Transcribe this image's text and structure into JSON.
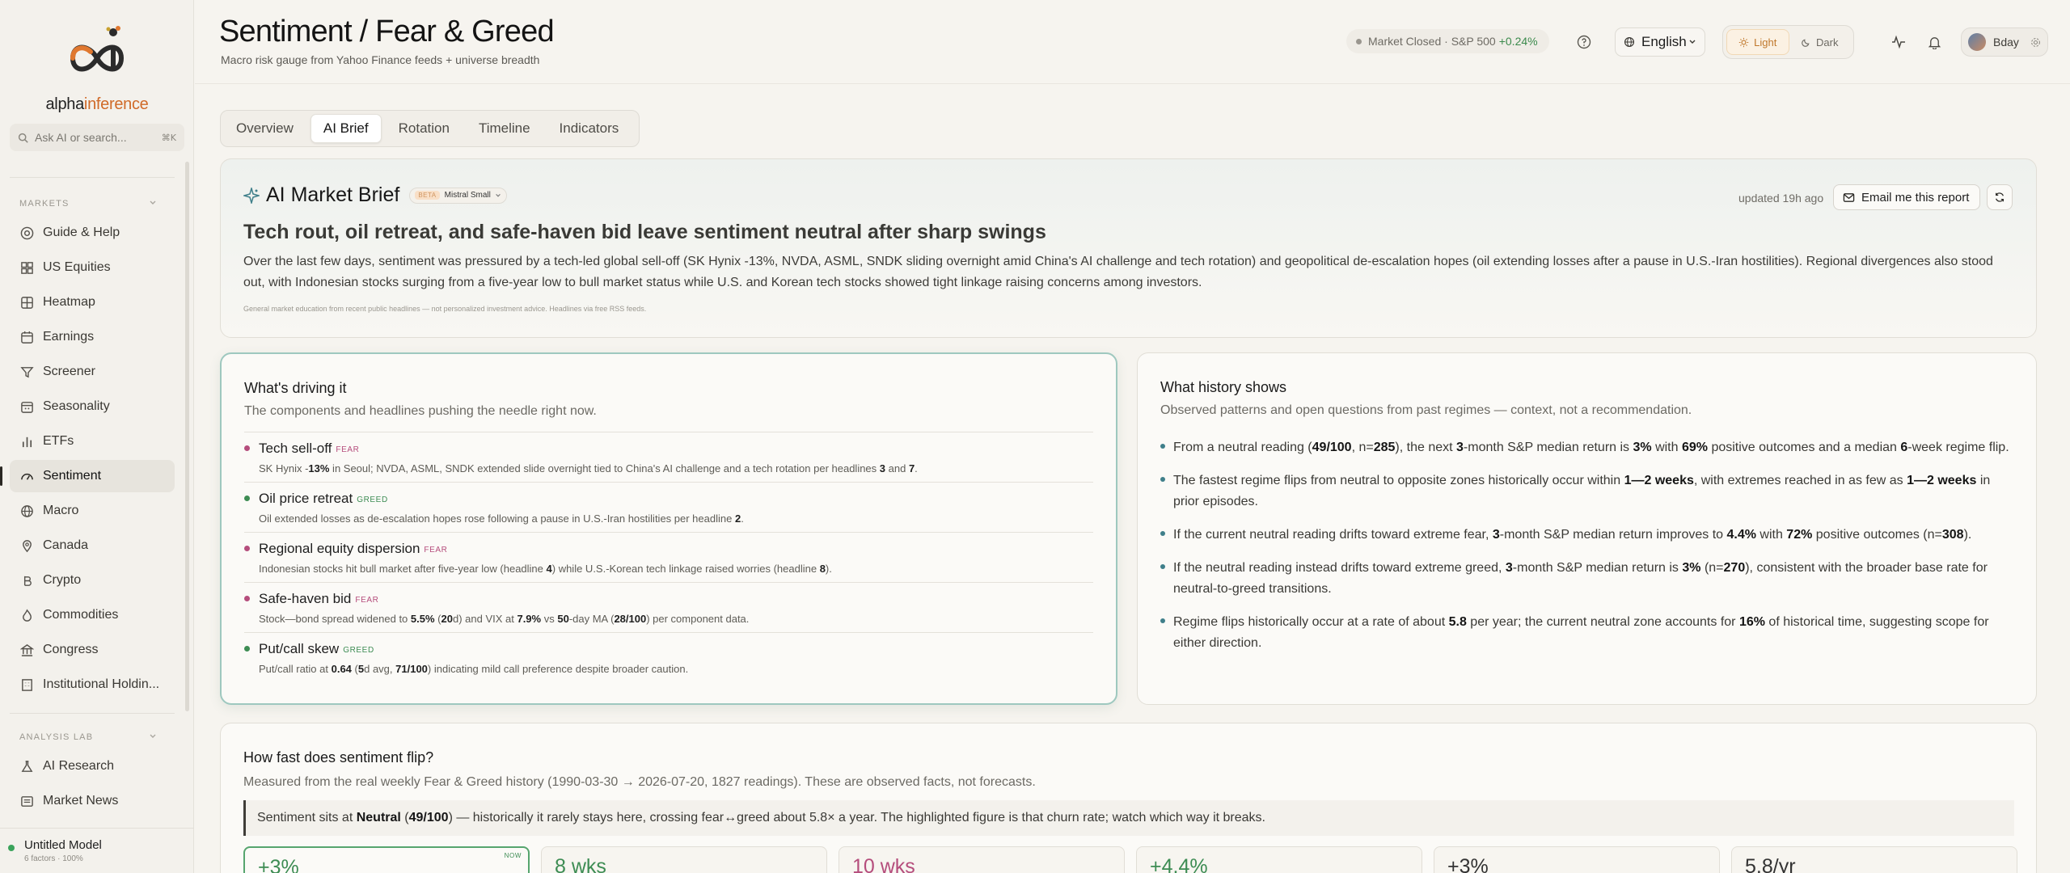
{
  "sidebar": {
    "brand_main": "alpha",
    "brand_accent": "inference",
    "search_placeholder": "Ask AI or search...",
    "search_kbd": "⌘K",
    "sections": [
      {
        "label": "MARKETS"
      },
      {
        "label": "ANALYSIS LAB"
      }
    ],
    "items": [
      {
        "label": "Guide & Help",
        "icon": "guide-icon"
      },
      {
        "label": "US Equities",
        "icon": "grid-icon"
      },
      {
        "label": "Heatmap",
        "icon": "heatmap-icon"
      },
      {
        "label": "Earnings",
        "icon": "calendar-icon"
      },
      {
        "label": "Screener",
        "icon": "filter-icon"
      },
      {
        "label": "Seasonality",
        "icon": "calendar-icon"
      },
      {
        "label": "ETFs",
        "icon": "bar-chart-icon"
      },
      {
        "label": "Sentiment",
        "icon": "gauge-icon",
        "active": true
      },
      {
        "label": "Macro",
        "icon": "globe-icon"
      },
      {
        "label": "Canada",
        "icon": "map-pin-icon"
      },
      {
        "label": "Crypto",
        "icon": "bitcoin-icon"
      },
      {
        "label": "Commodities",
        "icon": "flame-icon"
      },
      {
        "label": "Congress",
        "icon": "landmark-icon"
      },
      {
        "label": "Institutional Holdin...",
        "icon": "building-icon"
      }
    ],
    "lab_items": [
      {
        "label": "AI Research",
        "icon": "flask-icon"
      },
      {
        "label": "Market News",
        "icon": "newspaper-icon"
      }
    ],
    "model": {
      "name": "Untitled Model",
      "meta": "6 factors · 100%"
    }
  },
  "header": {
    "title": "Sentiment / Fear & Greed",
    "subtitle": "Macro risk gauge from Yahoo Finance feeds + universe breadth",
    "market_status": "Market Closed · S&P 500",
    "market_change": "+0.24%",
    "language": "English",
    "theme_light": "Light",
    "theme_dark": "Dark",
    "user": "Bday"
  },
  "tabs": [
    "Overview",
    "AI Brief",
    "Rotation",
    "Timeline",
    "Indicators"
  ],
  "brief": {
    "title": "AI Market Brief",
    "beta": "BETA",
    "model": "Mistral Small",
    "updated": "updated 19h ago",
    "email_label": "Email me this report",
    "headline": "Tech rout, oil retreat, and safe-haven bid leave sentiment neutral after sharp swings",
    "body": "Over the last few days, sentiment was pressured by a tech-led global sell-off (SK Hynix -13%, NVDA, ASML, SNDK sliding overnight amid China's AI challenge and tech rotation) and geopolitical de-escalation hopes (oil extending losses after a pause in U.S.-Iran hostilities). Regional divergences also stood out, with Indonesian stocks surging from a five-year low to bull market status while U.S. and Korean tech stocks showed tight linkage raising concerns among investors.",
    "note": "General market education from recent public headlines — not personalized investment advice. Headlines via free RSS feeds."
  },
  "drivers": {
    "title": "What's driving it",
    "subtitle": "The components and headlines pushing the needle right now.",
    "items": [
      {
        "title": "Tech sell-off",
        "tag": "FEAR",
        "d": [
          "SK Hynix -",
          "13%",
          " in Seoul; NVDA, ASML, SNDK extended slide overnight tied to China's AI challenge and a tech rotation per headlines ",
          "3",
          " and ",
          "7",
          "."
        ]
      },
      {
        "title": "Oil price retreat",
        "tag": "GREED",
        "d": [
          "Oil extended losses as de-escalation hopes rose following a pause in U.S.-Iran hostilities per headline ",
          "2",
          ".",
          "",
          "",
          "",
          ""
        ]
      },
      {
        "title": "Regional equity dispersion",
        "tag": "FEAR",
        "d": [
          "Indonesian stocks hit bull market after five-year low (headline ",
          "4",
          ") while U.S.-Korean tech linkage raised worries (headline ",
          "8",
          ").",
          "",
          ""
        ]
      },
      {
        "title": "Safe-haven bid",
        "tag": "FEAR",
        "d": [
          "Stock—bond spread widened to ",
          "5.5%",
          " (",
          "20",
          "d) and VIX at ",
          "7.9%",
          " vs ",
          "50",
          "-day MA (",
          "28/100",
          ") per component data."
        ]
      },
      {
        "title": "Put/call skew",
        "tag": "GREED",
        "d": [
          "Put/call ratio at ",
          "0.64",
          " (",
          "5",
          "d avg, ",
          "71/100",
          ") indicating mild call preference despite broader caution."
        ]
      }
    ]
  },
  "history": {
    "title": "What history shows",
    "subtitle": "Observed patterns and open questions from past regimes — context, not a recommendation.",
    "items": [
      [
        "From a neutral reading (",
        "49/100",
        ", n=",
        "285",
        "), the next ",
        "3",
        "-month S&P median return is ",
        "3%",
        " with ",
        "69%",
        " positive outcomes and a median ",
        "6",
        "-week regime flip."
      ],
      [
        "The fastest regime flips from neutral to opposite zones historically occur within ",
        "1—2 weeks",
        ", with extremes reached in as few as ",
        "1—2 weeks",
        " in prior episodes.",
        "",
        "",
        "",
        "",
        "",
        ""
      ],
      [
        "If the current neutral reading drifts toward extreme fear, ",
        "3",
        "-month S&P median return improves to ",
        "4.4%",
        " with ",
        "72%",
        " positive outcomes (n=",
        "308",
        ").",
        "",
        ""
      ],
      [
        "If the neutral reading instead drifts toward extreme greed, ",
        "3",
        "-month S&P median return is ",
        "3%",
        " (n=",
        "270",
        "), consistent with the broader base rate for neutral-to-greed transitions.",
        "",
        "",
        "",
        ""
      ],
      [
        "Regime flips historically occur at a rate of about ",
        "5.8",
        " per year; the current neutral zone accounts for ",
        "16%",
        " of historical time, suggesting scope for either direction.",
        "",
        "",
        "",
        "",
        "",
        ""
      ]
    ]
  },
  "flip": {
    "title": "How fast does sentiment flip?",
    "subtitle": "Measured from the real weekly Fear & Greed history (1990-03-30 → 2026-07-20, 1827 readings). These are observed facts, not forecasts.",
    "callout": [
      "Sentiment sits at ",
      "Neutral",
      " (",
      "49/100",
      ") — historically it rarely stays here, crossing fear↔greed about 5.8× a year. The highlighted figure is that churn rate; watch which way it breaks."
    ],
    "stats": [
      {
        "value": "+3%",
        "badge": "NOW"
      },
      {
        "value": "8 wks"
      },
      {
        "value": "10 wks"
      },
      {
        "value": "+4.4%"
      },
      {
        "value": "+3%"
      },
      {
        "value": "5.8/yr"
      }
    ]
  },
  "colors": {
    "fear": "#b54d7c",
    "greed": "#3d8c53",
    "accent": "#d06a28"
  }
}
